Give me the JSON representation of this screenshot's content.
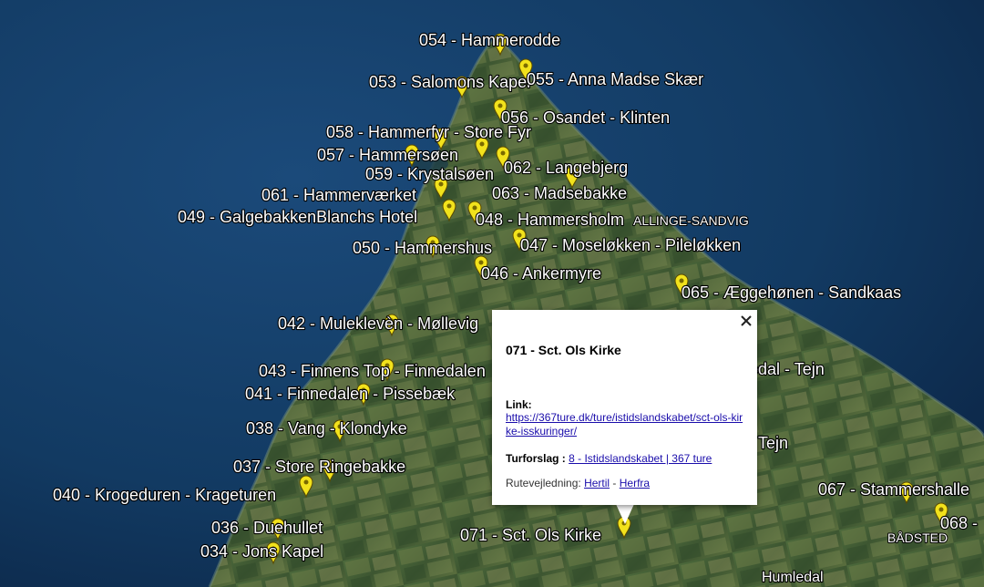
{
  "markers": [
    {
      "id": "m054",
      "label": "054 - Hammerodde"
    },
    {
      "id": "m053",
      "label": "053 - Salomons Kapel"
    },
    {
      "id": "m055",
      "label": "055 - Anna Madse Skær"
    },
    {
      "id": "m056",
      "label": "056 - Osandet - Klinten"
    },
    {
      "id": "m058",
      "label": "058 - Hammerfyr - Store Fyr"
    },
    {
      "id": "m057",
      "label": "057 - Hammersøen"
    },
    {
      "id": "m059",
      "label": "059 - Krystalsøen"
    },
    {
      "id": "m062",
      "label": "062 - Langebjerg"
    },
    {
      "id": "m061",
      "label": "061 - Hammerværket"
    },
    {
      "id": "m063",
      "label": "063  - Madsebakke"
    },
    {
      "id": "m049",
      "label": "049 - GalgebakkenBlanchs Hotel"
    },
    {
      "id": "m048",
      "label": "048 - Hammersholm"
    },
    {
      "id": "m050",
      "label": "050 - Hammershus"
    },
    {
      "id": "m047",
      "label": "047 - Moseløkken - Pileløkken"
    },
    {
      "id": "m046",
      "label": "046 - Ankermyre"
    },
    {
      "id": "m065",
      "label": "065 - Æggehønen - Sandkaas"
    },
    {
      "id": "m042",
      "label": "042 - Muleklevèn - Møllevig"
    },
    {
      "id": "m043",
      "label": "043 - Finnens Top - Finnedalen"
    },
    {
      "id": "m041",
      "label": "041 - Finnedalen - Pissebæk"
    },
    {
      "id": "m038",
      "label": "038 - Vang - Klondyke"
    },
    {
      "id": "m037",
      "label": "037 - Store Ringebakke"
    },
    {
      "id": "m040",
      "label": "040 - Krogeduren - Krageturen"
    },
    {
      "id": "m036",
      "label": "036 - Duehullet"
    },
    {
      "id": "m034",
      "label": "034 - Jons Kapel"
    },
    {
      "id": "m071",
      "label": "071 - Sct. Ols Kirke"
    },
    {
      "id": "m067",
      "label": "067 - Stammershalle"
    },
    {
      "id": "m068",
      "label": "068 -"
    },
    {
      "id": "mtejn1",
      "label": "redal - Tejn"
    },
    {
      "id": "mtejn2",
      "label": "Tejn"
    }
  ],
  "towns": {
    "allinge": "ALLINGE-SANDVIG",
    "badsted": "BÅDSTED",
    "humledal": "Humledal"
  },
  "popup": {
    "title": "071 - Sct. Ols Kirke",
    "link_label": "Link:",
    "link_url": "https://367ture.dk/ture/istidslandskabet/sct-ols-kirke-isskuringer/",
    "turforslag_label": "Turforslag :",
    "turforslag_link": "8 - Istidslandskabet | 367 ture",
    "rute_label": "Rutevejledning:",
    "rute_hertil": "Hertil",
    "rute_sep": " - ",
    "rute_herfra": "Herfra"
  },
  "icons": {
    "marker": "yellow-pushpin-icon",
    "close": "close-icon"
  },
  "colors": {
    "sea": "#12355a",
    "land": "#3f5a34",
    "marker": "#f2e21c",
    "link": "#1a0dab"
  }
}
